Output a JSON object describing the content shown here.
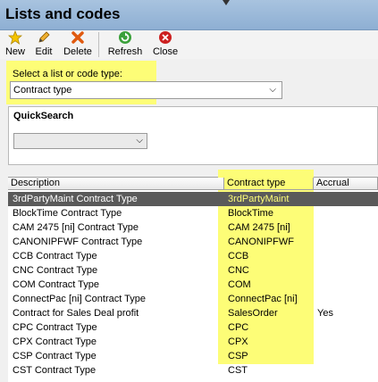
{
  "window": {
    "title": "Lists and codes"
  },
  "toolbar": {
    "buttons": [
      {
        "label": "New",
        "icon": "star-icon"
      },
      {
        "label": "Edit",
        "icon": "pencil-icon"
      },
      {
        "label": "Delete",
        "icon": "delete-x-icon"
      },
      {
        "label": "Refresh",
        "icon": "refresh-icon"
      },
      {
        "label": "Close",
        "icon": "close-icon"
      }
    ]
  },
  "type_selector": {
    "label": "Select a list or code type:",
    "value": "Contract type"
  },
  "quicksearch": {
    "title": "QuickSearch",
    "value": ""
  },
  "table": {
    "columns": [
      "Description",
      "Contract type",
      "Accrual"
    ],
    "rows": [
      {
        "description": "3rdPartyMaint Contract Type",
        "type": "3rdPartyMaint",
        "accrual": ""
      },
      {
        "description": "BlockTime Contract Type",
        "type": "BlockTime",
        "accrual": ""
      },
      {
        "description": "CAM 2475 [ni] Contract Type",
        "type": "CAM 2475 [ni]",
        "accrual": ""
      },
      {
        "description": "CANONIPFWF Contract Type",
        "type": "CANONIPFWF",
        "accrual": ""
      },
      {
        "description": "CCB Contract Type",
        "type": "CCB",
        "accrual": ""
      },
      {
        "description": "CNC Contract Type",
        "type": "CNC",
        "accrual": ""
      },
      {
        "description": "COM Contract Type",
        "type": "COM",
        "accrual": ""
      },
      {
        "description": "ConnectPac [ni] Contract Type",
        "type": "ConnectPac [ni]",
        "accrual": ""
      },
      {
        "description": "Contract for Sales Deal profit",
        "type": "SalesOrder",
        "accrual": "Yes"
      },
      {
        "description": "CPC Contract Type",
        "type": "CPC",
        "accrual": ""
      },
      {
        "description": "CPX Contract Type",
        "type": "CPX",
        "accrual": ""
      },
      {
        "description": "CSP Contract Type",
        "type": "CSP",
        "accrual": ""
      },
      {
        "description": "CST Contract Type",
        "type": "CST",
        "accrual": ""
      }
    ]
  },
  "colors": {
    "highlight": "#fdfd77",
    "selected_row": "#5a5a5a",
    "titlebar": "#9ab8d8"
  }
}
